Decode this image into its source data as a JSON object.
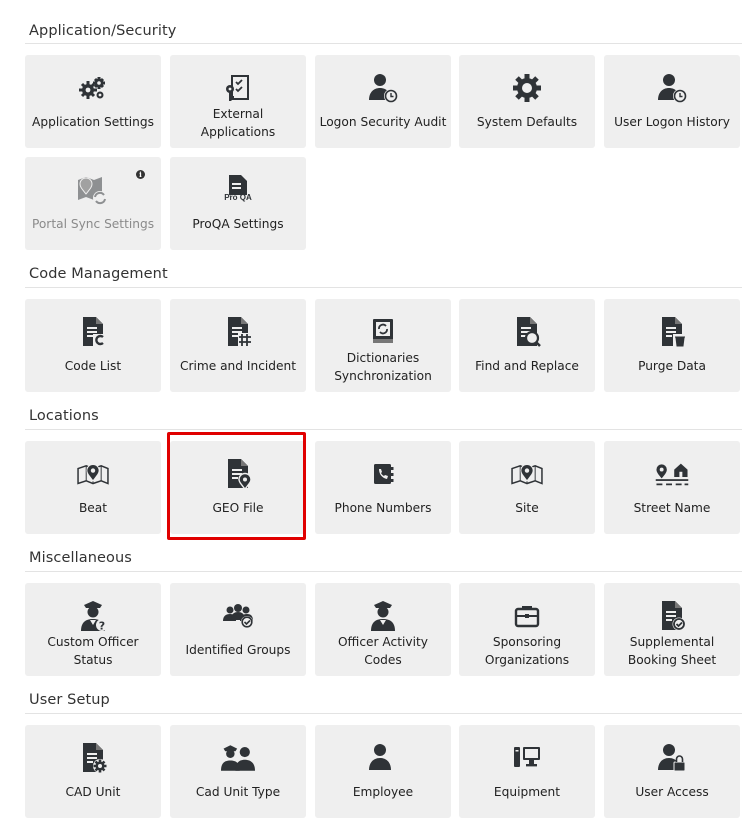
{
  "sections": [
    {
      "title": "Application/Security",
      "tiles": [
        {
          "label": "Application Settings",
          "icon": "gears-icon"
        },
        {
          "label": "External Applications",
          "icon": "external-apps-icon"
        },
        {
          "label": "Logon Security Audit",
          "icon": "user-clock-icon"
        },
        {
          "label": "System Defaults",
          "icon": "gear-icon"
        },
        {
          "label": "User Logon History",
          "icon": "user-clock-icon"
        },
        {
          "label": "Portal Sync Settings",
          "icon": "map-sync-icon",
          "disabled": true,
          "badge": "i"
        },
        {
          "label": "ProQA Settings",
          "icon": "proqa-doc-icon",
          "icon_text": "Pro QA"
        }
      ]
    },
    {
      "title": "Code Management",
      "tiles": [
        {
          "label": "Code List",
          "icon": "doc-code-icon"
        },
        {
          "label": "Crime and Incident",
          "icon": "doc-hash-icon"
        },
        {
          "label": "Dictionaries Synchronization",
          "icon": "book-sync-icon"
        },
        {
          "label": "Find and Replace",
          "icon": "doc-search-icon"
        },
        {
          "label": "Purge Data",
          "icon": "doc-trash-icon"
        }
      ]
    },
    {
      "title": "Locations",
      "tiles": [
        {
          "label": "Beat",
          "icon": "map-pin-icon"
        },
        {
          "label": "GEO File",
          "icon": "doc-pin-icon",
          "highlighted": true
        },
        {
          "label": "Phone Numbers",
          "icon": "phone-book-icon"
        },
        {
          "label": "Site",
          "icon": "map-pin-icon"
        },
        {
          "label": "Street Name",
          "icon": "street-house-icon"
        }
      ]
    },
    {
      "title": "Miscellaneous",
      "tiles": [
        {
          "label": "Custom Officer Status",
          "icon": "officer-question-icon"
        },
        {
          "label": "Identified Groups",
          "icon": "group-check-icon"
        },
        {
          "label": "Officer Activity Codes",
          "icon": "officer-icon"
        },
        {
          "label": "Sponsoring Organizations",
          "icon": "briefcase-icon"
        },
        {
          "label": "Supplemental Booking Sheet",
          "icon": "doc-check-icon"
        }
      ]
    },
    {
      "title": "User Setup",
      "tiles": [
        {
          "label": "CAD Unit",
          "icon": "doc-gear-icon"
        },
        {
          "label": "Cad Unit Type",
          "icon": "officers-icon"
        },
        {
          "label": "Employee",
          "icon": "user-icon"
        },
        {
          "label": "Equipment",
          "icon": "computer-icon"
        },
        {
          "label": "User Access",
          "icon": "user-lock-icon"
        }
      ]
    }
  ],
  "colors": {
    "tile_bg": "#efefef",
    "icon": "#2f3337",
    "highlight": "#e00000"
  }
}
